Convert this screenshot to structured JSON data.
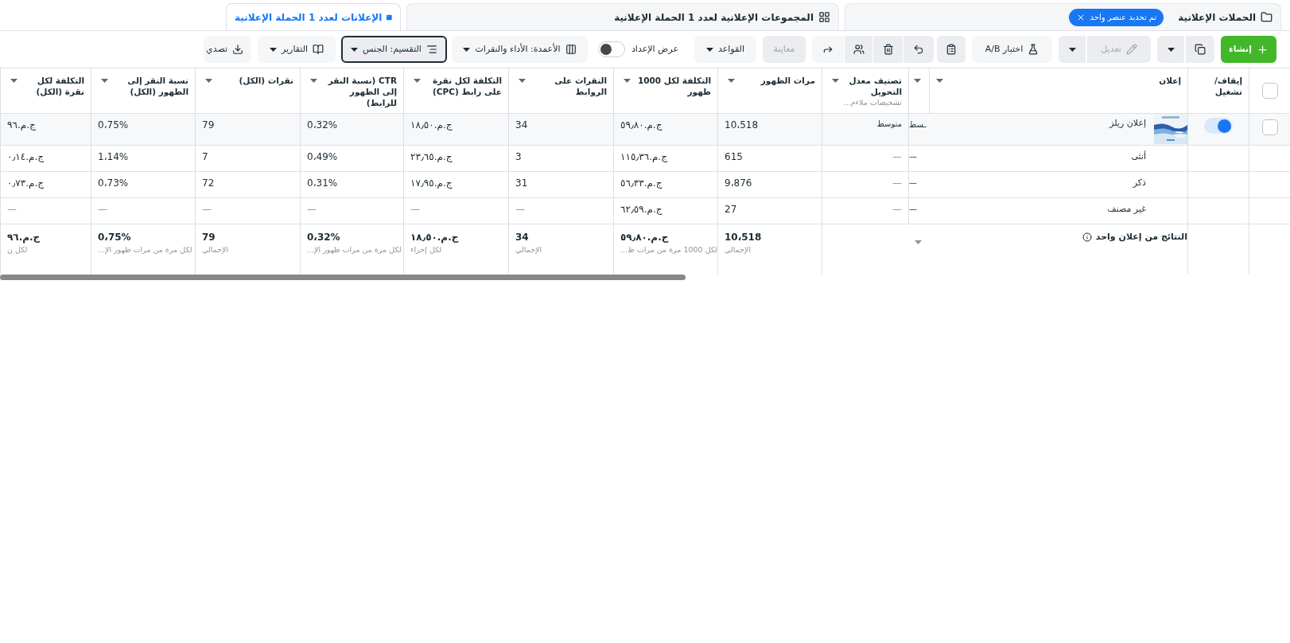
{
  "tabs": [
    {
      "kind": "campaigns",
      "label": "الحملات الإعلانية",
      "selected": false,
      "badge": "تم تحديد عنصر واحد"
    },
    {
      "kind": "adsets",
      "label": "المجموعات الإعلانية لعدد 1 الحملة الإعلانية",
      "selected": false
    },
    {
      "kind": "ads",
      "label": "الإعلانات لعدد 1 الحملة الإعلانية",
      "selected": true
    }
  ],
  "toolbar": [
    {
      "kind": "create",
      "label": "إنشاء"
    },
    {
      "kind": "duplicate"
    },
    {
      "kind": "edit",
      "label": "تعديل",
      "disabled": true
    },
    {
      "kind": "ab_test",
      "label": "اختبار A/B"
    },
    {
      "kind": "notes"
    },
    {
      "kind": "undo"
    },
    {
      "kind": "delete"
    },
    {
      "kind": "audience"
    },
    {
      "kind": "share"
    },
    {
      "kind": "preview",
      "label": "معاينة",
      "disabled": true
    },
    {
      "kind": "rules",
      "label": "القواعد"
    },
    {
      "kind": "setup_toggle",
      "label": "عرض الإعداد",
      "on": false
    },
    {
      "kind": "columns",
      "label": "الأعمدة: الأداء والنقرات"
    },
    {
      "kind": "breakdown",
      "label": "التقسيم: الجنس",
      "active": true
    },
    {
      "kind": "reports",
      "label": "التقارير"
    },
    {
      "kind": "export",
      "label": "تصدي"
    }
  ],
  "table": {
    "select_all": {
      "checked": false
    },
    "toggle_header": "إيقاف/ تشغيل",
    "name_header": "إعلان",
    "columns": [
      {
        "label": "تصنيف معدل التحويل",
        "sub": "تشخيصات ملاءم..."
      },
      {
        "label": "مرات الظهور"
      },
      {
        "label": "التكلفة لكل 1000 ظهور"
      },
      {
        "label": "النقرات على الروابط"
      },
      {
        "label": "التكلفة لكل نقرة على رابط (CPC)"
      },
      {
        "label": "CTR (نسبة النقر إلى الظهور للرابط)"
      },
      {
        "label": "نقرات (الكل)"
      },
      {
        "label": "نسبة النقر إلى الظهور (الكل)"
      },
      {
        "label": "التكلفة لكل نقرة (الكل)"
      }
    ],
    "rows": [
      {
        "kind": "ad",
        "checked": false,
        "on": true,
        "name": "إعلان ريلز",
        "clipped": "ـسط",
        "cells": [
          "متوسط",
          "10،518",
          "ج.م.٥٩٫٨٠",
          "34",
          "ج.م.١٨٫٥٠",
          "0،32%",
          "79",
          "0،75%",
          "ج.م.٩٦"
        ]
      },
      {
        "kind": "breakdown",
        "name": "أنثى",
        "clipped": "—",
        "cells": [
          "—",
          "615",
          "ج.م.١١٥٫٣٦",
          "3",
          "ج.م.٢٣٫٦٥",
          "0،49%",
          "7",
          "1،14%",
          "ج.م.٠٫١٤"
        ]
      },
      {
        "kind": "breakdown",
        "name": "ذكر",
        "clipped": "—",
        "cells": [
          "—",
          "9،876",
          "ج.م.٥٦٫٣٣",
          "31",
          "ج.م.١٧٫٩٥",
          "0،31%",
          "72",
          "0،73%",
          "ج.م.٠٫٧٣"
        ]
      },
      {
        "kind": "breakdown",
        "name": "غير مصنف",
        "clipped": "—",
        "cells": [
          "—",
          "27",
          "ج.م.٦٢٫٥٩",
          "—",
          "—",
          "—",
          "—",
          "—",
          "—"
        ]
      }
    ],
    "totals": {
      "label": "النتائج من إعلان واحد",
      "cells": [
        {
          "value": "10،518",
          "sub": "الإجمالي"
        },
        {
          "value": "ج.م.٥٩٫٨٠",
          "sub": "لكل 1000 مرة من مرات ظ..."
        },
        {
          "value": "34",
          "sub": "الإجمالي"
        },
        {
          "value": "ج.م.١٨٫٥٠",
          "sub": "لكل إجراء"
        },
        {
          "value": "0،32%",
          "sub": "لكل مرة من مرات ظهور الإ..."
        },
        {
          "value": "79",
          "sub": "الإجمالي"
        },
        {
          "value": "0،75%",
          "sub": "لكل مرة من مرات ظهور الإ..."
        },
        {
          "value": "ج.م.٩٦",
          "sub": "لكل ن"
        }
      ]
    }
  }
}
